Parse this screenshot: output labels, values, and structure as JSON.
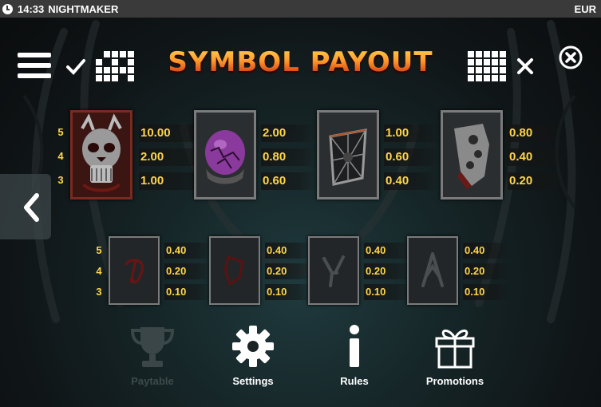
{
  "status_bar": {
    "time": "14:33",
    "game": "NIGHTMAKER",
    "currency": "EUR"
  },
  "title": "SYMBOL PAYOUT",
  "high_symbols": [
    {
      "name": "skull",
      "color": "#8a1a14",
      "rows": [
        {
          "count": "5",
          "pay": "10.00"
        },
        {
          "count": "4",
          "pay": "2.00"
        },
        {
          "count": "3",
          "pay": "1.00"
        }
      ]
    },
    {
      "name": "purple-orb",
      "color": "#7a3a8a",
      "rows": [
        {
          "count": "",
          "pay": "2.00"
        },
        {
          "count": "",
          "pay": "0.80"
        },
        {
          "count": "",
          "pay": "0.60"
        }
      ]
    },
    {
      "name": "web-cage",
      "color": "#555555",
      "rows": [
        {
          "count": "",
          "pay": "1.00"
        },
        {
          "count": "",
          "pay": "0.60"
        },
        {
          "count": "",
          "pay": "0.40"
        }
      ]
    },
    {
      "name": "bone-fragment",
      "color": "#6a6a6a",
      "rows": [
        {
          "count": "",
          "pay": "0.80"
        },
        {
          "count": "",
          "pay": "0.40"
        },
        {
          "count": "",
          "pay": "0.20"
        }
      ]
    }
  ],
  "low_symbols": [
    {
      "name": "rune-a",
      "rows": [
        {
          "count": "5",
          "pay": "0.40"
        },
        {
          "count": "4",
          "pay": "0.20"
        },
        {
          "count": "3",
          "pay": "0.10"
        }
      ]
    },
    {
      "name": "rune-k",
      "rows": [
        {
          "count": "",
          "pay": "0.40"
        },
        {
          "count": "",
          "pay": "0.20"
        },
        {
          "count": "",
          "pay": "0.10"
        }
      ]
    },
    {
      "name": "rune-q",
      "rows": [
        {
          "count": "",
          "pay": "0.40"
        },
        {
          "count": "",
          "pay": "0.20"
        },
        {
          "count": "",
          "pay": "0.10"
        }
      ]
    },
    {
      "name": "rune-j",
      "rows": [
        {
          "count": "",
          "pay": "0.40"
        },
        {
          "count": "",
          "pay": "0.20"
        },
        {
          "count": "",
          "pay": "0.10"
        }
      ]
    }
  ],
  "nav": {
    "paytable": "Paytable",
    "settings": "Settings",
    "rules": "Rules",
    "promotions": "Promotions"
  }
}
